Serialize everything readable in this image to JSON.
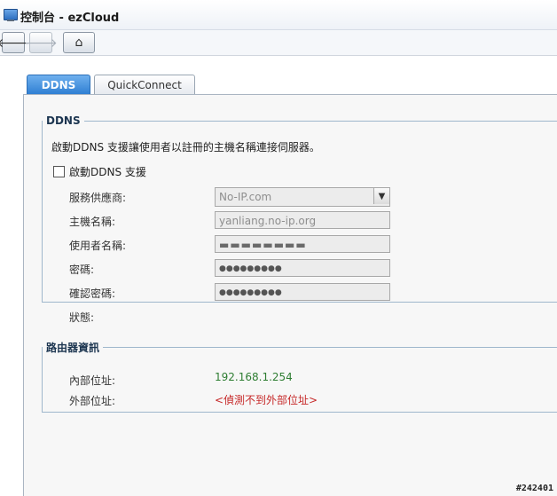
{
  "window": {
    "title": "控制台 - ezCloud"
  },
  "toolbar": {
    "back_label": "🡐",
    "forward_label": "🡒",
    "home_label": "⌂"
  },
  "tabs": [
    {
      "label": "DDNS",
      "active": true
    },
    {
      "label": "QuickConnect",
      "active": false
    }
  ],
  "ddns": {
    "legend": "DDNS",
    "description": "啟動DDNS 支援讓使用者以註冊的主機名稱連接伺服器。",
    "enable_label": "啟動DDNS 支援",
    "enabled": false,
    "provider_label": "服務供應商:",
    "provider_value": "No-IP.com",
    "hostname_label": "主機名稱:",
    "hostname_value": "yanliang.no-ip.org",
    "username_label": "使用者名稱:",
    "username_value": "▬▬▬▬▬▬▬▬",
    "password_label": "密碼:",
    "password_value": "●●●●●●●●●",
    "confirm_label": "確認密碼:",
    "confirm_value": "●●●●●●●●●",
    "status_label": "狀態:",
    "status_value": ""
  },
  "router": {
    "legend": "路由器資訊",
    "internal_label": "內部位址:",
    "internal_value": "192.168.1.254",
    "external_label": "外部位址:",
    "external_value": "<偵測不到外部位址>"
  },
  "watermark": "#242401",
  "colors": {
    "accent": "#2f7fd3",
    "ok": "#2e7d32",
    "error": "#c62828"
  }
}
